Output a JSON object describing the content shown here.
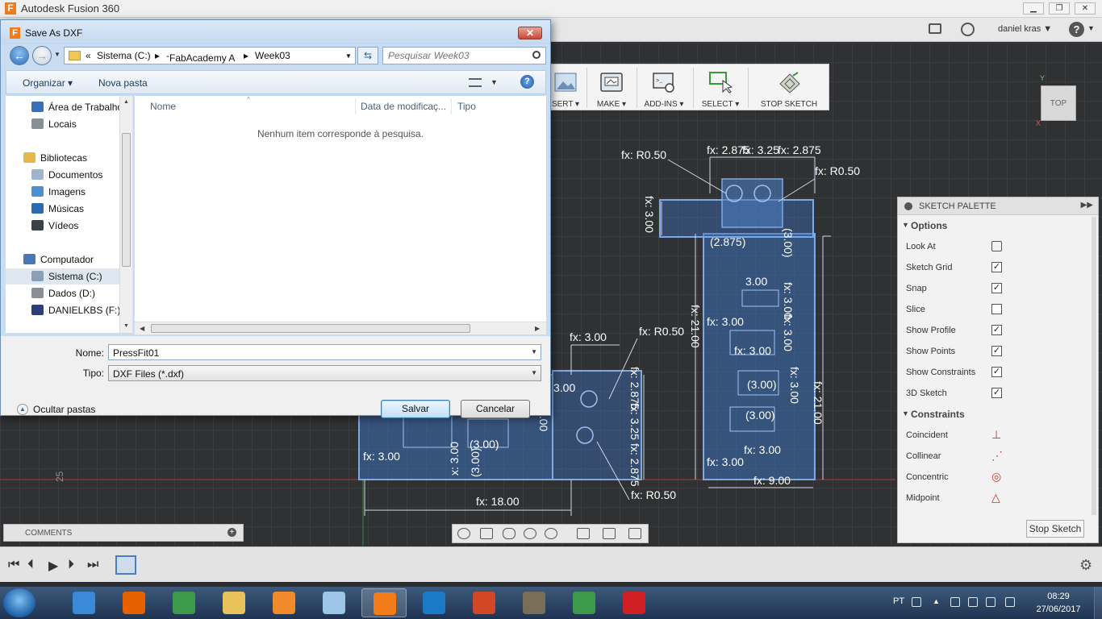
{
  "window": {
    "title": "Autodesk Fusion 360",
    "app_icon_letter": "F"
  },
  "appbar": {
    "user": "daniel kras",
    "user_caret": "▼",
    "help": "?"
  },
  "toolbar": {
    "items": [
      {
        "label": "SERT ▾",
        "icon": "insert-image-icon"
      },
      {
        "label": "MAKE ▾",
        "icon": "make-icon"
      },
      {
        "label": "ADD-INS ▾",
        "icon": "add-ins-icon"
      },
      {
        "label": "SELECT ▾",
        "icon": "select-icon"
      },
      {
        "label": "STOP SKETCH",
        "icon": "stop-sketch-icon"
      }
    ]
  },
  "viewcube": {
    "face": "TOP",
    "axis_y": "Y",
    "axis_x": "X"
  },
  "palette": {
    "title": "SKETCH PALETTE",
    "options_title": "Options",
    "options": [
      {
        "label": "Look At",
        "control": "look-at-icon"
      },
      {
        "label": "Sketch Grid",
        "checked": "✓"
      },
      {
        "label": "Snap",
        "checked": "✓"
      },
      {
        "label": "Slice",
        "checked": ""
      },
      {
        "label": "Show Profile",
        "checked": "✓"
      },
      {
        "label": "Show Points",
        "checked": "✓"
      },
      {
        "label": "Show Constraints",
        "checked": "✓"
      },
      {
        "label": "3D Sketch",
        "checked": "✓"
      }
    ],
    "constraints_title": "Constraints",
    "constraints": [
      {
        "label": "Coincident",
        "glyph": "⊥",
        "color": "#c0392b"
      },
      {
        "label": "Collinear",
        "glyph": "⋰",
        "color": "#c0392b"
      },
      {
        "label": "Concentric",
        "glyph": "◎",
        "color": "#c0392b"
      },
      {
        "label": "Midpoint",
        "glyph": "△",
        "color": "#c0392b"
      }
    ],
    "stop_button": "Stop Sketch"
  },
  "canvas": {
    "grid_label": "25",
    "dimensions": {
      "r050_a": "fx: R0.50",
      "r050_b": "fx: R0.50",
      "r050_c": "fx: R0.50",
      "r050_d": "fx: R0.50",
      "top_2875": "fx: 2.875",
      "top_325": "fx: 3.25",
      "top_2875b": "fx: 2.875",
      "v300_left": "fx: 3.00",
      "v2875": "(2.875)",
      "v300_paren": "(3.00)",
      "h300_inner": "3.00",
      "v2100_left": "fx: 21.00",
      "fx300_a": "fx: 3.00",
      "fx300_b": "fx: 3.00",
      "fx300_c": "fx: 3.00",
      "p300_a": "(3.00)",
      "p300_b": "(3.00)",
      "v300_r1": "fx: 3.00",
      "v300_r2": "fx: 3.00",
      "v300_r3": "fx: 3.00",
      "v2100_right": "fx: 21.00",
      "fx300_bottom": "fx: 3.00",
      "fx900": "fx: 9.00",
      "fx300_small": "fx: 3.00",
      "fx300_mid": "fx: 3.00",
      "d300_b": "3.00",
      "d300_c": "3.00",
      "v2875_mid": "fx: 2.875",
      "v325_mid": "fx: 3.25",
      "v2875_b": "fx: 2.875",
      "p300_mid": "(3.00)",
      "v300_low": "x: 3.00",
      "p300_low": "(3.00)",
      "fx1800": "fx: 18.00",
      "fx300_left": "fx: 3.00"
    }
  },
  "comments": {
    "label": "COMMENTS",
    "plus": "+"
  },
  "timeline": {
    "first": "⏮",
    "prev": "⏴",
    "play": "▶",
    "next": "⏵",
    "last": "⏭",
    "settings": "⚙"
  },
  "dialog": {
    "title": "Save As DXF",
    "close": "✕",
    "address": {
      "prefix": "«",
      "parts": [
        "Sistema (C:)",
        "FabAcademy A",
        "Week03"
      ],
      "separators": [
        "▸",
        "▸"
      ]
    },
    "search_placeholder": "Pesquisar Week03",
    "commands": {
      "organize": "Organizar ▾",
      "new_folder": "Nova pasta"
    },
    "nav": [
      {
        "label": "Área de Trabalho",
        "icon": "desktop-icon",
        "color": "#3a6fb5",
        "indent": 30
      },
      {
        "label": "Locais",
        "icon": "recent-places-icon",
        "color": "#8a8f96",
        "indent": 30
      },
      {
        "label": "Bibliotecas",
        "icon": "libraries-icon",
        "color": "#e6b84a",
        "indent": 20
      },
      {
        "label": "Documentos",
        "icon": "documents-icon",
        "color": "#9fb4cc",
        "indent": 30
      },
      {
        "label": "Imagens",
        "icon": "pictures-icon",
        "color": "#4f8fd0",
        "indent": 30
      },
      {
        "label": "Músicas",
        "icon": "music-icon",
        "color": "#2c69b0",
        "indent": 30
      },
      {
        "label": "Vídeos",
        "icon": "videos-icon",
        "color": "#3a3f4a",
        "indent": 30
      },
      {
        "label": "Computador",
        "icon": "computer-icon",
        "color": "#4a78b6",
        "indent": 20
      },
      {
        "label": "Sistema (C:)",
        "icon": "drive-c-icon",
        "color": "#8aa0b8",
        "indent": 30,
        "selected": true
      },
      {
        "label": "Dados (D:)",
        "icon": "drive-d-icon",
        "color": "#8a8f96",
        "indent": 30
      },
      {
        "label": "DANIELKBS (F:)",
        "icon": "usb-drive-icon",
        "color": "#2c3e7a",
        "indent": 30
      }
    ],
    "columns": [
      "Nome",
      "Data de modificaç...",
      "Tipo"
    ],
    "empty_message": "Nenhum item corresponde à pesquisa.",
    "filename_label": "Nome:",
    "filename_value": "PressFit01",
    "type_label": "Tipo:",
    "type_value": "DXF Files (*.dxf)",
    "hide_folders": "Ocultar pastas",
    "save": "Salvar",
    "cancel": "Cancelar"
  },
  "taskbar": {
    "apps": [
      {
        "name": "internet-explorer",
        "color": "#3b8ad8"
      },
      {
        "name": "firefox",
        "color": "#e66000"
      },
      {
        "name": "chrome",
        "color": "#3c9a4a"
      },
      {
        "name": "file-explorer",
        "color": "#e8c35a"
      },
      {
        "name": "media-player",
        "color": "#f08a2a"
      },
      {
        "name": "notepad",
        "color": "#9cc5e8"
      },
      {
        "name": "fusion-360",
        "color": "#f27b1a"
      },
      {
        "name": "app-bracket",
        "color": "#1a7ac8"
      },
      {
        "name": "powerpoint",
        "color": "#d24726"
      },
      {
        "name": "gimp",
        "color": "#7a6e58"
      },
      {
        "name": "chrome-2",
        "color": "#3c9a4a"
      },
      {
        "name": "solidworks",
        "color": "#d11f26"
      }
    ],
    "lang": "PT",
    "time": "08:29",
    "date": "27/06/2017"
  }
}
